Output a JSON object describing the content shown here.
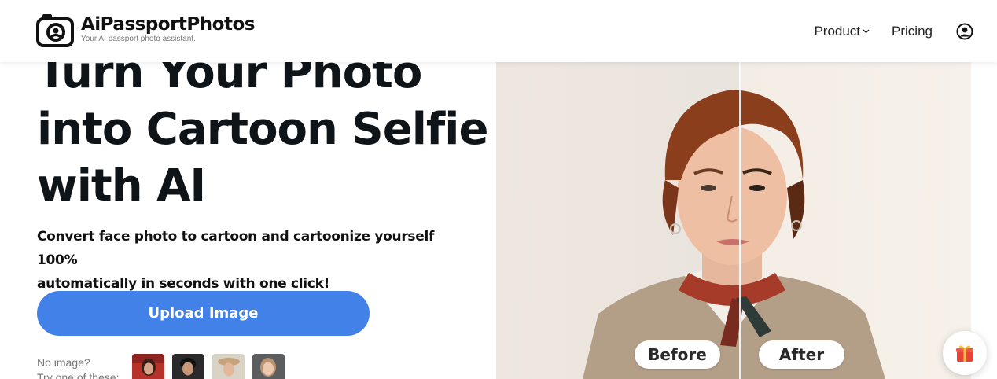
{
  "header": {
    "brand_name": "AiPassportPhotos",
    "brand_tagline": "Your AI passport photo assistant.",
    "nav": {
      "product_label": "Product",
      "pricing_label": "Pricing"
    },
    "icons": [
      "camera-logo-icon",
      "chevron-down-icon",
      "user-account-icon"
    ]
  },
  "hero": {
    "title_lines": [
      "Turn Your Photo",
      "into Cartoon Selfie",
      "with AI"
    ],
    "subtitle_lines": [
      "Convert face photo to cartoon and cartoonize yourself 100%",
      "automatically in seconds with one click!"
    ],
    "upload_button_label": "Upload Image",
    "no_image_lines": [
      "No image?",
      "Try one of these:"
    ],
    "sample_count": 4
  },
  "comparison": {
    "before_label": "Before",
    "after_label": "After"
  },
  "colors": {
    "accent": "#4282e8",
    "title_text": "#0f1419",
    "background": "#ffffff"
  },
  "floating": {
    "gift_icon": "gift-icon"
  }
}
